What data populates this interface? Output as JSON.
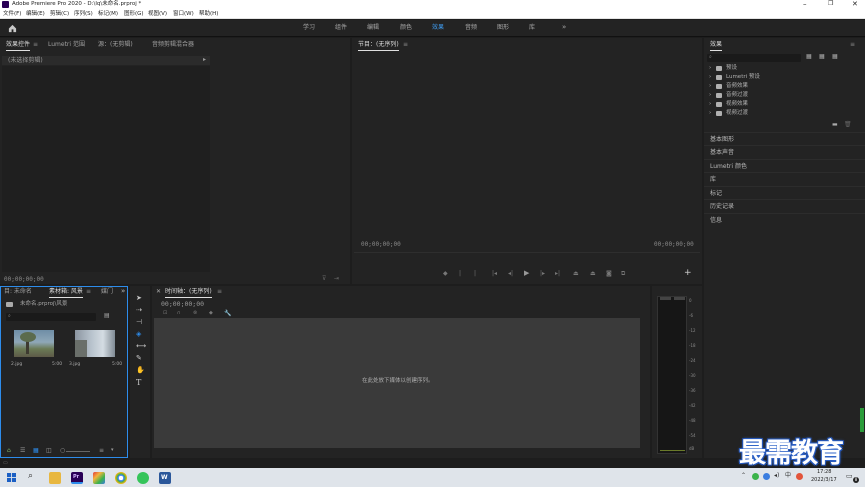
{
  "title": "Adobe Premiere Pro 2020 - D:\\lq\\未命名.prproj *",
  "menu": [
    "文件(F)",
    "编辑(E)",
    "剪辑(C)",
    "序列(S)",
    "标记(M)",
    "图形(G)",
    "视图(V)",
    "窗口(W)",
    "帮助(H)"
  ],
  "workspaces": [
    "学习",
    "组件",
    "编辑",
    "颜色",
    "效果",
    "音频",
    "图形",
    "库"
  ],
  "active_workspace": "效果",
  "source_panel": {
    "tabs": [
      "效果控件",
      "Lumetri 范围",
      "源：(无剪辑)",
      "音频剪辑混合器"
    ],
    "no_clip": "(未选择剪辑)",
    "timecode": "00;00;00;00"
  },
  "program_panel": {
    "tab": "节目：(无序列)",
    "timecode_left": "00;00;00;00",
    "timecode_right": "00;00;00;00"
  },
  "effects_panel": {
    "title": "效果",
    "tree": [
      "预设",
      "Lumetri 预设",
      "音频效果",
      "音频过渡",
      "视频效果",
      "视频过渡"
    ],
    "sections": [
      "基本图形",
      "基本声音",
      "Lumetri 颜色",
      "库",
      "标记",
      "历史记录",
      "信息"
    ]
  },
  "project_panel": {
    "tabs": [
      "目: 未命名",
      "素材箱: 风景",
      "媒门"
    ],
    "path": "未命名.prproj\\风景",
    "items": [
      {
        "name": "2.jpg",
        "duration": "5:00"
      },
      {
        "name": "3.jpg",
        "duration": "5:00"
      }
    ]
  },
  "timeline": {
    "tab": "时间轴：(无序列)",
    "timecode": "00;00;00;00",
    "drop_hint": "在此处放下媒体以创建序列。"
  },
  "meter_scale": [
    "0",
    "-6",
    "-12",
    "-18",
    "-24",
    "-30",
    "-36",
    "-42",
    "-48",
    "-54",
    "dB"
  ],
  "watermark": "最需教育",
  "clock": {
    "time": "17:28",
    "date": "2022/3/17"
  },
  "tray_badge": "8",
  "colors": {
    "accent": "#2d8ceb",
    "pr_purple": "#2a0056"
  }
}
